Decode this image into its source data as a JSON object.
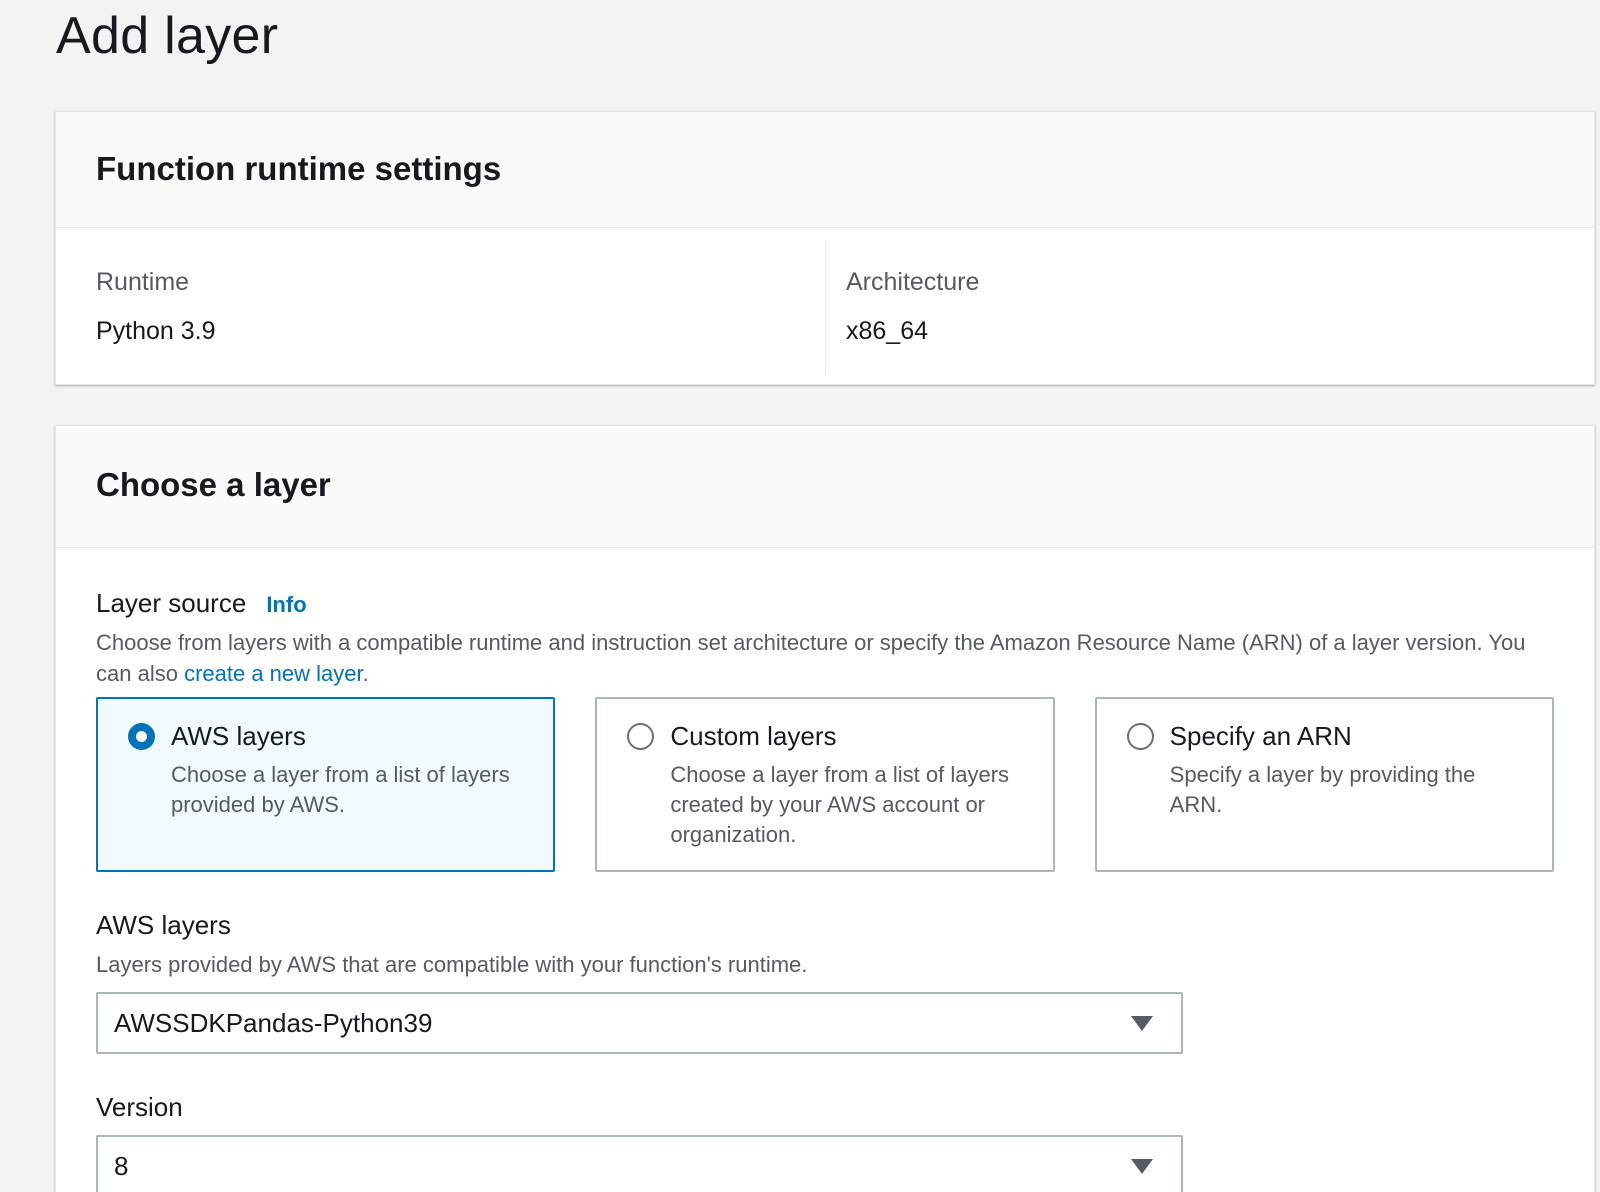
{
  "page": {
    "title": "Add layer"
  },
  "runtime_panel": {
    "title": "Function runtime settings",
    "runtime_label": "Runtime",
    "runtime_value": "Python 3.9",
    "architecture_label": "Architecture",
    "architecture_value": "x86_64"
  },
  "layer_panel": {
    "title": "Choose a layer",
    "layer_source": {
      "label": "Layer source",
      "info": "Info",
      "description_prefix": "Choose from layers with a compatible runtime and instruction set architecture or specify the Amazon Resource Name (ARN) of a layer version. You can also ",
      "description_link": "create a new layer",
      "description_suffix": ".",
      "options": [
        {
          "title": "AWS layers",
          "description": "Choose a layer from a list of layers provided by AWS.",
          "selected": true
        },
        {
          "title": "Custom layers",
          "description": "Choose a layer from a list of layers created by your AWS account or organization.",
          "selected": false
        },
        {
          "title": "Specify an ARN",
          "description": "Specify a layer by providing the ARN.",
          "selected": false
        }
      ]
    },
    "aws_layers": {
      "label": "AWS layers",
      "description": "Layers provided by AWS that are compatible with your function's runtime.",
      "selected": "AWSSDKPandas-Python39"
    },
    "version": {
      "label": "Version",
      "selected": "8"
    }
  },
  "colors": {
    "accent": "#0073bb",
    "selected_tile_bg": "#f1faff",
    "page_bg": "#f2f3f3"
  },
  "icons": [
    "radio-checked-icon",
    "radio-unchecked-icon",
    "caret-down-icon"
  ]
}
